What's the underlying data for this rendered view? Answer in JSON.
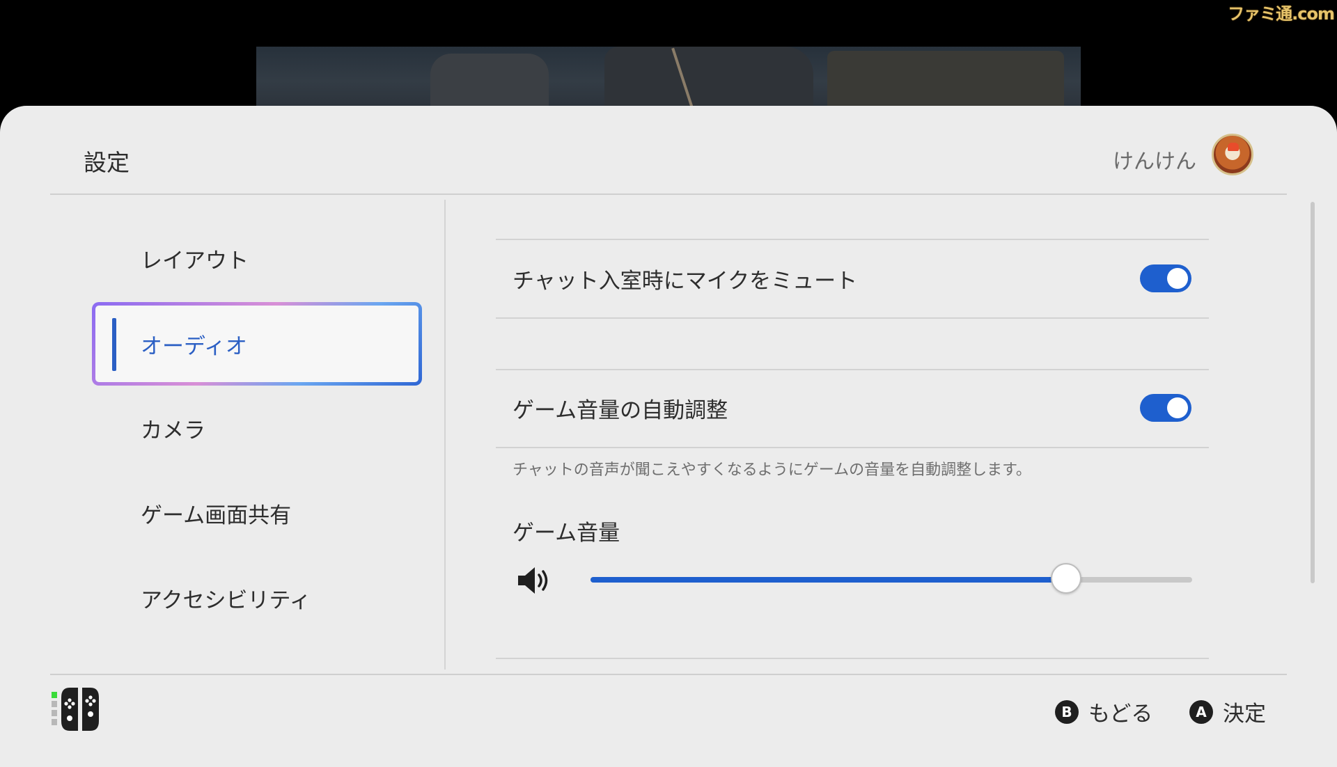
{
  "watermark": "ファミ通.com",
  "header": {
    "title": "設定",
    "user_name": "けんけん"
  },
  "sidebar": {
    "items": [
      {
        "label": "レイアウト",
        "selected": false
      },
      {
        "label": "オーディオ",
        "selected": true
      },
      {
        "label": "カメラ",
        "selected": false
      },
      {
        "label": "ゲーム画面共有",
        "selected": false
      },
      {
        "label": "アクセシビリティ",
        "selected": false
      }
    ]
  },
  "settings": {
    "mute_on_join": {
      "label": "チャット入室時にマイクをミュート",
      "enabled": true
    },
    "auto_adjust": {
      "label": "ゲーム音量の自動調整",
      "enabled": true,
      "description": "チャットの音声が聞こえやすくなるようにゲームの音量を自動調整します。"
    },
    "game_volume": {
      "label": "ゲーム音量",
      "level_percent": 79
    }
  },
  "footer": {
    "back": {
      "glyph": "B",
      "label": "もどる"
    },
    "confirm": {
      "glyph": "A",
      "label": "決定"
    }
  },
  "colors": {
    "accent": "#1e5fce",
    "panel_bg": "#ececec",
    "connected_indicator": "#3adb3a"
  },
  "icons": [
    "speaker-icon",
    "joycon-icon",
    "b-button-icon",
    "a-button-icon",
    "avatar"
  ]
}
